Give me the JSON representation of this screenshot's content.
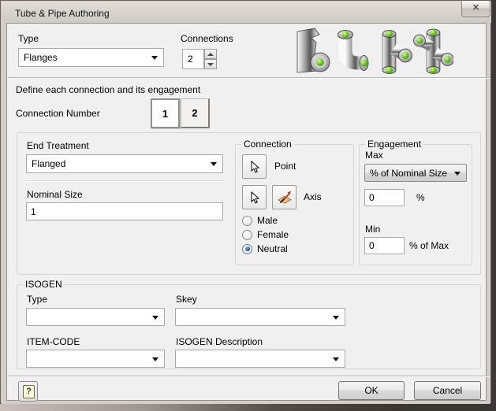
{
  "window": {
    "title": "Tube & Pipe Authoring",
    "close_glyph": "✕"
  },
  "top": {
    "type_label": "Type",
    "type_value": "Flanges",
    "connections_label": "Connections",
    "connections_value": "2",
    "fittings": [
      "1-connection-flange",
      "2-connection-elbow",
      "3-connection-tee",
      "4-connection-cross"
    ]
  },
  "define": {
    "text": "Define each connection and its engagement",
    "connection_number_label": "Connection Number",
    "buttons": [
      "1",
      "2"
    ],
    "selected": "1"
  },
  "detail": {
    "end_treatment_label": "End Treatment",
    "end_treatment_value": "Flanged",
    "nominal_size_label": "Nominal Size",
    "nominal_size_value": "1"
  },
  "connection": {
    "title": "Connection",
    "point_label": "Point",
    "axis_label": "Axis",
    "genders": [
      {
        "label": "Male"
      },
      {
        "label": "Female"
      },
      {
        "label": "Neutral"
      }
    ],
    "gender_selected": "Neutral"
  },
  "engagement": {
    "title": "Engagement",
    "max_label": "Max",
    "max_value": "% of Nominal Size",
    "max_percent_value": "0",
    "max_percent_suffix": "%",
    "min_label": "Min",
    "min_value": "0",
    "min_suffix": "% of Max"
  },
  "isogen": {
    "title": "ISOGEN",
    "fields": [
      {
        "label": "Type",
        "value": ""
      },
      {
        "label": "Skey",
        "value": ""
      },
      {
        "label": "ITEM-CODE",
        "value": ""
      },
      {
        "label": "ISOGEN Description",
        "value": ""
      }
    ]
  },
  "footer": {
    "help_glyph": "?",
    "ok_label": "OK",
    "cancel_label": "Cancel"
  },
  "colors": {
    "accent_green": "#5bbf1d",
    "selection_blue": "#1c4f8f",
    "dialog_bg": "#f0f0f0",
    "frame": "#d3cec8"
  }
}
